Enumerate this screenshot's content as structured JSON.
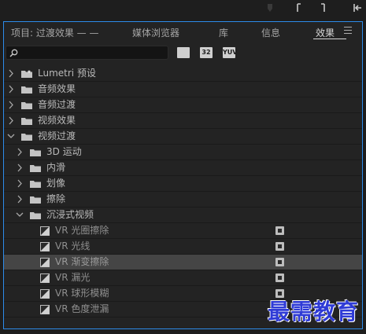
{
  "tabs": [
    {
      "label": "项目: 过渡效果 — —",
      "active": false
    },
    {
      "label": "媒体浏览器",
      "active": false
    },
    {
      "label": "库",
      "active": false
    },
    {
      "label": "信息",
      "active": false
    },
    {
      "label": "效果",
      "active": true
    }
  ],
  "search": {
    "value": "",
    "placeholder": ""
  },
  "filters": {
    "accelerated": "",
    "bit32": "32",
    "yuv": "YUV"
  },
  "tree": [
    {
      "label": "Lumetri 预设",
      "kind": "folder-preset",
      "expanded": false
    },
    {
      "label": "音频效果",
      "kind": "folder",
      "expanded": false
    },
    {
      "label": "音频过渡",
      "kind": "folder",
      "expanded": false
    },
    {
      "label": "视频效果",
      "kind": "folder",
      "expanded": false
    },
    {
      "label": "视频过渡",
      "kind": "folder",
      "expanded": true
    },
    {
      "label": "3D 运动",
      "kind": "subfolder",
      "expanded": false
    },
    {
      "label": "内滑",
      "kind": "subfolder",
      "expanded": false
    },
    {
      "label": "划像",
      "kind": "subfolder",
      "expanded": false
    },
    {
      "label": "擦除",
      "kind": "subfolder",
      "expanded": false
    },
    {
      "label": "沉浸式视频",
      "kind": "subfolder",
      "expanded": true
    },
    {
      "label": "VR 光圈擦除",
      "kind": "effect",
      "selected": false
    },
    {
      "label": "VR 光线",
      "kind": "effect",
      "selected": false
    },
    {
      "label": "VR 渐变擦除",
      "kind": "effect",
      "selected": true
    },
    {
      "label": "VR 漏光",
      "kind": "effect",
      "selected": false
    },
    {
      "label": "VR 球形模糊",
      "kind": "effect",
      "selected": false
    },
    {
      "label": "VR 色度泄漏",
      "kind": "effect",
      "selected": false
    }
  ],
  "watermark": "最需教育",
  "colors": {
    "focus_border": "#2d8ceb",
    "selected_row": "#454545",
    "watermark": "#2f3bd6"
  }
}
